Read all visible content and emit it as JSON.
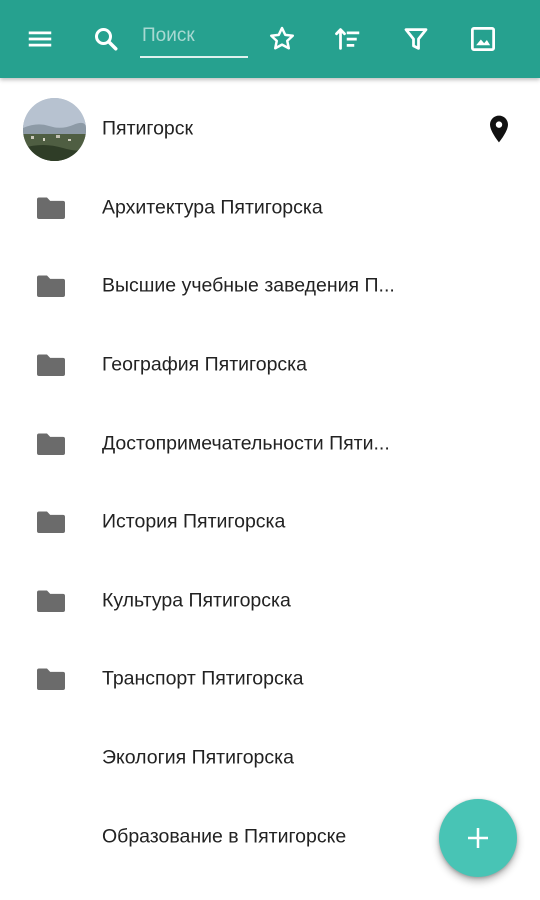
{
  "colors": {
    "toolbar": "#26a18f",
    "fab": "#48c4b5",
    "folder_icon": "#6b6b6b",
    "text": "#222222"
  },
  "toolbar": {
    "menu_icon": "menu-icon",
    "search_icon": "search-icon",
    "search_placeholder": "Поиск",
    "search_value": "",
    "favorite_icon": "star-outline-icon",
    "sort_icon": "sort-icon",
    "filter_icon": "filter-icon",
    "image_icon": "image-icon"
  },
  "header_item": {
    "label": "Пятигорск",
    "trailing_icon": "location-pin-icon"
  },
  "items": [
    {
      "label": "Архитектура Пятигорска",
      "icon": "folder-icon"
    },
    {
      "label": "Высшие учебные заведения П...",
      "icon": "folder-icon"
    },
    {
      "label": "География Пятигорска",
      "icon": "folder-icon"
    },
    {
      "label": "Достопримечательности Пяти...",
      "icon": "folder-icon"
    },
    {
      "label": "История Пятигорска",
      "icon": "folder-icon"
    },
    {
      "label": "Культура Пятигорска",
      "icon": "folder-icon"
    },
    {
      "label": "Транспорт Пятигорска",
      "icon": "folder-icon"
    },
    {
      "label": "Экология Пятигорска",
      "icon": ""
    },
    {
      "label": "Образование в Пятигорске",
      "icon": ""
    }
  ],
  "fab": {
    "icon": "plus-icon"
  }
}
